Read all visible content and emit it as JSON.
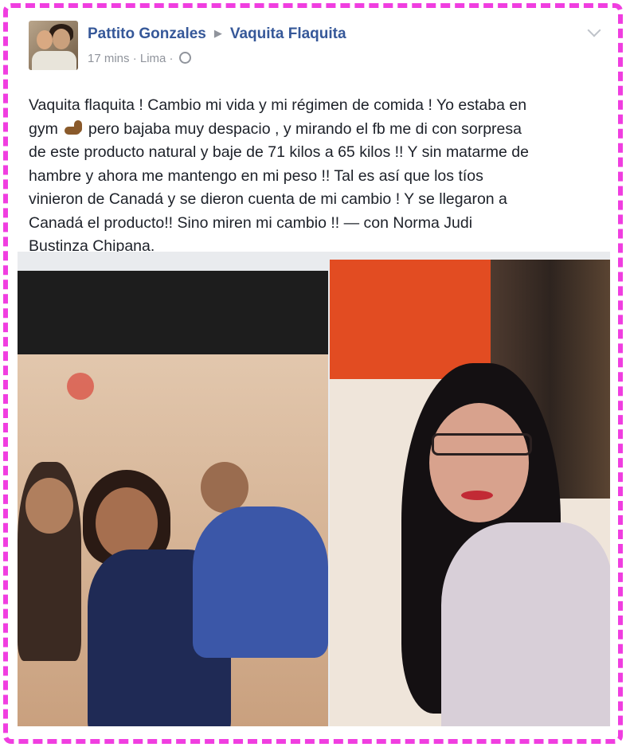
{
  "post": {
    "author": "Pattito Gonzales",
    "group": "Vaquita Flaquita",
    "time": "17 mins",
    "location": "Lima",
    "lines": [
      "Vaquita flaquita ! Cambio mi vida y mi régimen de comida ! Yo estaba en",
      "pero bajaba muy despacio , y mirando el fb me di con sorpresa",
      "de este producto natural y baje de 71 kilos a 65 kilos !! Y sin matarme de",
      "hambre y ahora me mantengo en mi peso !! Tal es así que los tíos",
      "vinieron de Canadá y se dieron cuenta de mi cambio ! Y se llegaron a",
      "Canadá el producto!! Sino miren mi cambio !! — con Norma Judi",
      "Bustinza Chipana."
    ],
    "gym_word": "gym"
  },
  "icons": {
    "arm": "flexed-biceps-icon",
    "globe": "globe-icon",
    "chevron": "chevron-down-icon",
    "arrow": "triangle-right-icon"
  },
  "colors": {
    "border": "#f03ee0",
    "link": "#365899",
    "meta": "#90949c",
    "text": "#1d2129"
  }
}
